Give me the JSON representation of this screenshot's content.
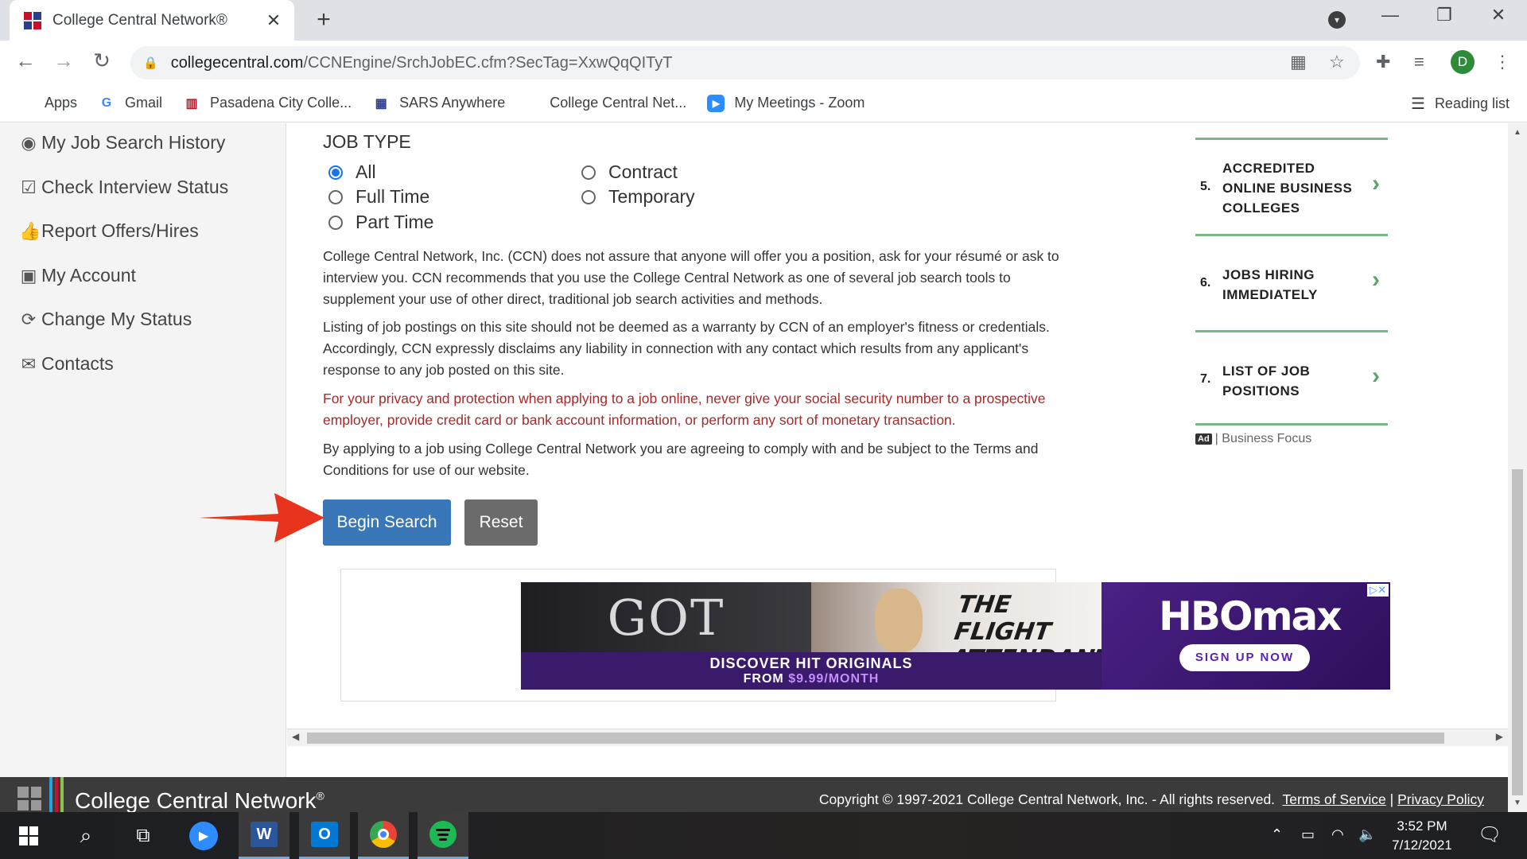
{
  "browser": {
    "tab_title": "College Central Network®",
    "url_host": "collegecentral.com",
    "url_path": "/CCNEngine/SrchJobEC.cfm?SecTag=XxwQqQITyT",
    "profile_initial": "D",
    "bookmarks": [
      {
        "label": "Apps",
        "icon": "apps-grid-icon"
      },
      {
        "label": "Gmail",
        "icon": "google-icon"
      },
      {
        "label": "Pasadena City Colle...",
        "icon": "pcc-icon"
      },
      {
        "label": "SARS Anywhere",
        "icon": "calendar-icon"
      },
      {
        "label": "College Central Net...",
        "icon": "ccn-icon"
      },
      {
        "label": "My Meetings - Zoom",
        "icon": "zoom-icon"
      }
    ],
    "reading_list": "Reading list"
  },
  "sidebar": {
    "items": [
      {
        "label": "My Job Search History",
        "icon": "eye-icon"
      },
      {
        "label": "Check Interview Status",
        "icon": "check-square-icon"
      },
      {
        "label": "Report Offers/Hires",
        "icon": "thumbs-up-icon"
      },
      {
        "label": "My Account",
        "icon": "account-icon"
      },
      {
        "label": "Change My Status",
        "icon": "refresh-icon"
      },
      {
        "label": "Contacts",
        "icon": "envelope-icon"
      }
    ]
  },
  "form": {
    "job_type_label": "JOB TYPE",
    "options": [
      {
        "label": "All",
        "checked": true
      },
      {
        "label": "Full Time",
        "checked": false
      },
      {
        "label": "Part Time",
        "checked": false
      },
      {
        "label": "Contract",
        "checked": false
      },
      {
        "label": "Temporary",
        "checked": false
      }
    ],
    "disclaimer_1": "College Central Network, Inc. (CCN) does not assure that anyone will offer you a position, ask for your résumé or ask to interview you. CCN recommends that you use the College Central Network as one of several job search tools to supplement your use of other direct, traditional job search activities and methods.",
    "disclaimer_2": "Listing of job postings on this site should not be deemed as a warranty by CCN of an employer's fitness or credentials. Accordingly, CCN expressly disclaims any liability in connection with any contact which results from any applicant's response to any job posted on this site.",
    "privacy_warning": "For your privacy and protection when applying to a job online, never give your social security number to a prospective employer, provide credit card or bank account information, or perform any sort of monetary transaction.",
    "terms_note": "By applying to a job using College Central Network you are agreeing to comply with and be subject to the Terms and Conditions for use of our website.",
    "begin_search": "Begin Search",
    "reset": "Reset"
  },
  "ad_banner": {
    "show_1": "GOT",
    "show_2": "THE FLIGHT ATTENDANT",
    "tagline_1": "DISCOVER HIT ORIGINALS",
    "tagline_2_prefix": "FROM ",
    "tagline_2_price": "$9.99/MONTH",
    "brand": "HBOmax",
    "cta": "SIGN UP NOW"
  },
  "promo": {
    "items": [
      {
        "num": "5.",
        "label": "ACCREDITED ONLINE BUSINESS COLLEGES"
      },
      {
        "num": "6.",
        "label": "JOBS HIRING IMMEDIATELY"
      },
      {
        "num": "7.",
        "label": "LIST OF JOB POSITIONS"
      }
    ],
    "ad_badge": "Ad",
    "sponsor": "| Business Focus"
  },
  "footer": {
    "brand": "College Central Network",
    "copyright": "Copyright © 1997-2021 College Central Network, Inc. - All rights reserved.",
    "terms": "Terms of Service",
    "separator": "|",
    "privacy": "Privacy Policy"
  },
  "taskbar": {
    "time": "3:52 PM",
    "date": "7/12/2021",
    "word_letter": "W",
    "outlook_letter": "O"
  },
  "colors": {
    "primary_button": "#3a77b8",
    "reset_button": "#6b6b6b",
    "promo_accent": "#76b887",
    "privacy_text": "#a52a2a",
    "arrow": "#e8341c"
  }
}
